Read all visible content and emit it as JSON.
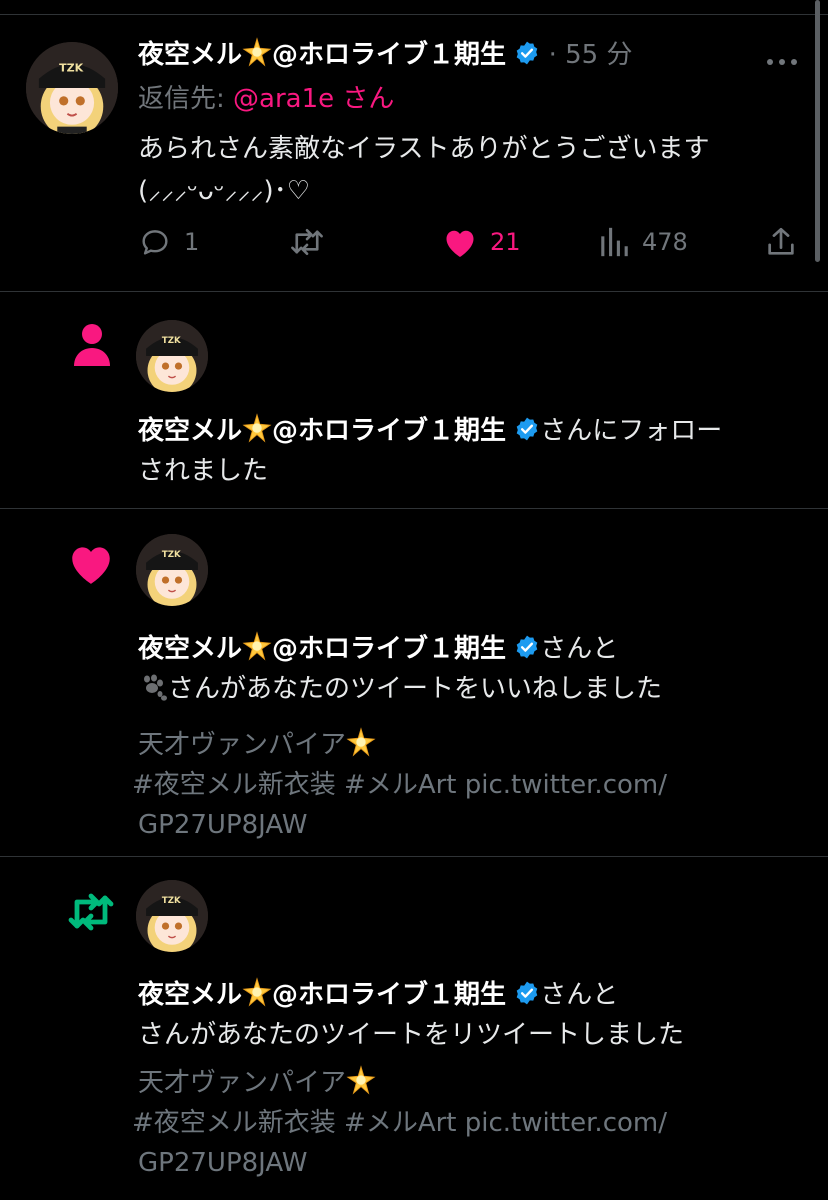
{
  "reply": {
    "display_name": "夜空メル",
    "suffix": "@ホロライブ１期生",
    "time": "· 55 分",
    "reply_to_label": "返信先:",
    "reply_to_handle": "@ara1e",
    "reply_to_san": "さん",
    "body_line1": "あられさん素敵なイラストありがとうございます",
    "body_line2": "(⸝⸝⸝ᵕᴗᵕ⸝⸝⸝)･♡",
    "actions": {
      "comments": "1",
      "retweets": "",
      "likes": "21",
      "views": "478"
    }
  },
  "follow_notification": {
    "display_name": "夜空メル",
    "suffix": "@ホロライブ１期生",
    "text_after_name": "さんにフォロー",
    "text_line2": "されました"
  },
  "like_notification": {
    "display_name": "夜空メル",
    "suffix": "@ホロライブ１期生",
    "text_after_name": "さんと",
    "text_line2": "さんがあなたのツイートをいいねしました",
    "tweet_line1": "天才ヴァンパイア",
    "tweet_line2": " #夜空メル新衣装 #メルArt pic.twitter.com/",
    "tweet_line3": "GP27UP8JAW"
  },
  "retweet_notification": {
    "display_name": "夜空メル",
    "suffix": "@ホロライブ１期生",
    "text_after_name": "さんと",
    "text_line2": "さんがあなたのツイートをリツイートしました",
    "tweet_line1": "天才ヴァンパイア",
    "tweet_line2": " #夜空メル新衣装 #メルArt pic.twitter.com/",
    "tweet_line3": "GP27UP8JAW"
  },
  "icons": {
    "verified": "verified-badge-icon",
    "star": "glowing-star-emoji",
    "paw": "paw-prints-emoji",
    "more": "more-dots-icon",
    "comment": "comment-icon",
    "retweet": "retweet-icon",
    "like": "heart-icon",
    "views": "views-icon",
    "share": "share-icon",
    "person": "person-icon"
  },
  "colors": {
    "background": "#000000",
    "text": "#e7e9ea",
    "muted": "#71767b",
    "accent_pink": "#f91880",
    "retweet_green": "#00ba7c",
    "verified_blue": "#1d9bf0"
  }
}
